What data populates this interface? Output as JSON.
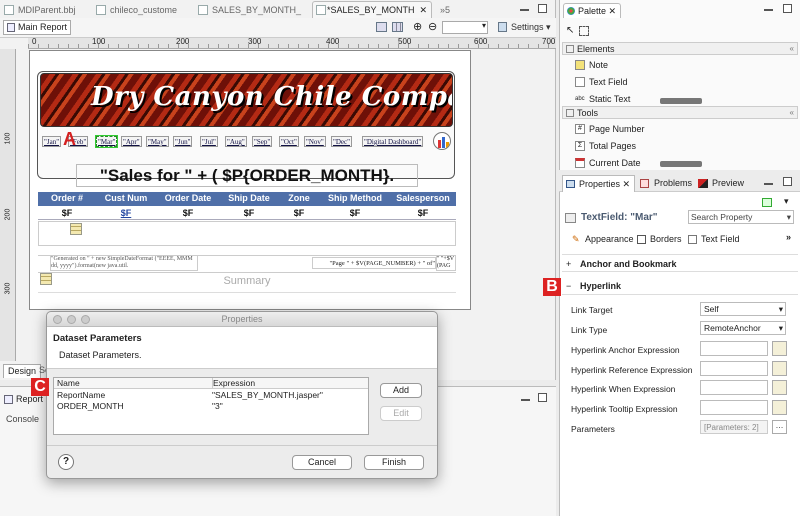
{
  "editor_tabs": [
    "MDIParent.bbj",
    "chileco_custome",
    "SALES_BY_MONTH_",
    "*SALES_BY_MONTH"
  ],
  "editor_tabs_overflow": "»5",
  "toolbar": {
    "main_report": "Main Report",
    "zoom_value": "",
    "settings_label": "Settings"
  },
  "ruler_marks": [
    "0",
    "100",
    "200",
    "300",
    "400",
    "500",
    "600",
    "700"
  ],
  "vruler_marks": [
    "100",
    "200",
    "300"
  ],
  "report": {
    "company": "Dry Canyon Chile Company",
    "months": [
      "\"Jan\"",
      "\"Feb\"",
      "\"Mar\"",
      "\"Apr\"",
      "\"May\"",
      "\"Jun\"",
      "\"Jul\"",
      "\"Aug\"",
      "\"Sep\"",
      "\"Oct\"",
      "\"Nov\"",
      "\"Dec\""
    ],
    "dashboard_label": "\"Digital Dashboard\"",
    "sales_expression": "\"Sales for \" + ( $P{ORDER_MONTH}.",
    "columns": [
      "Order #",
      "Cust Num",
      "Order Date",
      "Ship Date",
      "Zone",
      "Ship Method",
      "Salesperson"
    ],
    "fields": [
      "$F",
      "$F",
      "$F",
      "$F",
      "$F",
      "$F",
      "$F"
    ],
    "footer_left": "\"Generated on \" + new SimpleDateFormat (\"EEEE, MMM dd, yyyy\").format(new java.util.",
    "footer_right": "\"Page \" + $V(PAGE_NUMBER) + \" of\"",
    "footer_far": "\" \"+$V (PAG",
    "summary": "Summary"
  },
  "bottom_tabs": {
    "design": "Design",
    "source": "So",
    "report_state": "Report",
    "console": "Console"
  },
  "palette": {
    "title": "Palette",
    "elements_header": "Elements",
    "elements": [
      "Note",
      "Text Field",
      "Static Text"
    ],
    "tools_header": "Tools",
    "tools": [
      "Page Number",
      "Total Pages",
      "Current Date"
    ]
  },
  "properties_panel": {
    "tabs": [
      "Properties",
      "Problems",
      "Preview"
    ],
    "selected_title": "TextField: \"Mar\"",
    "search_placeholder": "Search Property",
    "subtabs": [
      "Appearance",
      "Borders",
      "Text Field"
    ],
    "sections": [
      "Anchor and Bookmark",
      "Hyperlink"
    ],
    "rows": [
      {
        "label": "Link Target",
        "value": "Self"
      },
      {
        "label": "Link Type",
        "value": "RemoteAnchor"
      },
      {
        "label": "Hyperlink Anchor Expression",
        "value": ""
      },
      {
        "label": "Hyperlink Reference Expression",
        "value": ""
      },
      {
        "label": "Hyperlink When Expression",
        "value": ""
      },
      {
        "label": "Hyperlink Tooltip Expression",
        "value": ""
      },
      {
        "label": "Parameters",
        "value": "[Parameters: 2]"
      }
    ]
  },
  "dialog": {
    "title": "Properties",
    "heading": "Dataset Parameters",
    "description": "Dataset Parameters.",
    "col_name": "Name",
    "col_expression": "Expression",
    "params": [
      {
        "name": "ReportName",
        "expression": "\"SALES_BY_MONTH.jasper\""
      },
      {
        "name": "ORDER_MONTH",
        "expression": "\"3\""
      }
    ],
    "add": "Add",
    "edit": "Edit",
    "cancel": "Cancel",
    "finish": "Finish",
    "help": "?"
  },
  "callouts": [
    "A",
    "B",
    "C"
  ],
  "colors": {
    "header_blue": "#4f6fa8",
    "accent_red": "#d42020",
    "banner_red": "#8a1a10"
  }
}
